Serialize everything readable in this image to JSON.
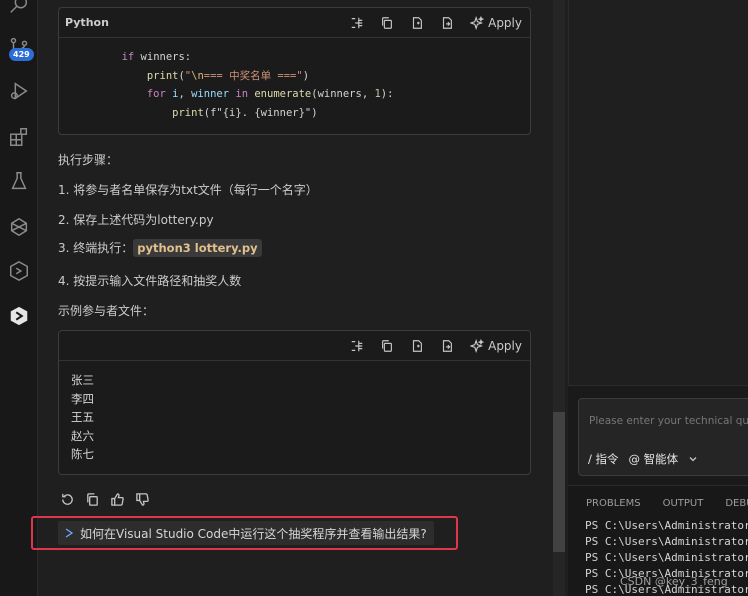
{
  "activity_bar": {
    "items": [
      {
        "icon": "search-icon"
      },
      {
        "icon": "source-control-icon",
        "badge": "429"
      },
      {
        "icon": "run-debug-icon"
      },
      {
        "icon": "extensions-icon"
      },
      {
        "icon": "testing-icon"
      },
      {
        "icon": "ai-assistant-icon"
      },
      {
        "icon": "hexagon-icon"
      },
      {
        "icon": "code-assistant-icon"
      }
    ]
  },
  "chat": {
    "code_block_1": {
      "language": "Python",
      "apply_label": "Apply",
      "lines": {
        "l1_kw": "if",
        "l1_rest": " winners:",
        "l2_fn": "print",
        "l2_p": "(",
        "l2_str1": "\"",
        "l2_esc": "\\n",
        "l2_str2": "=== 中奖名单 ===\"",
        "l2_end": ")",
        "l3_kw1": "for",
        "l3_v": " i, winner ",
        "l3_kw2": "in",
        "l3_fn": " enumerate",
        "l3_p": "(winners, ",
        "l3_num": "1",
        "l3_end": "):",
        "l4_fn": "print",
        "l4_p": "(f\"{i}. {winner}\")"
      }
    },
    "steps_title": "执行步骤：",
    "step1": "1. 将参与者名单保存为txt文件（每行一个名字）",
    "step2": "2. 保存上述代码为lottery.py",
    "step3_prefix": "3. 终端执行：",
    "step3_code": "python3 lottery.py",
    "step4": "4. 按提示输入文件路径和抽奖人数",
    "sample_title": "示例参与者文件：",
    "code_block_2": {
      "apply_label": "Apply",
      "lines": [
        "张三",
        "李四",
        "王五",
        "赵六",
        "陈七"
      ]
    },
    "suggestion": "如何在Visual Studio Code中运行这个抽奖程序并查看输出结果?"
  },
  "input": {
    "placeholder": "Please enter your technical quest",
    "command": "/ 指令",
    "agent": "@ 智能体"
  },
  "panel": {
    "tabs": [
      "PROBLEMS",
      "OUTPUT",
      "DEBUG"
    ],
    "terminal_lines": [
      "PS C:\\Users\\Administrator",
      "PS C:\\Users\\Administrator",
      "PS C:\\Users\\Administrator",
      "PS C:\\Users\\Administrator",
      "PS C:\\Users\\Administrator"
    ]
  },
  "watermark": "CSDN @key_3_feng",
  "colors": {
    "highlight_border": "#e0364b",
    "badge": "#2b6fd6",
    "inline_code": "#e2c08d"
  }
}
